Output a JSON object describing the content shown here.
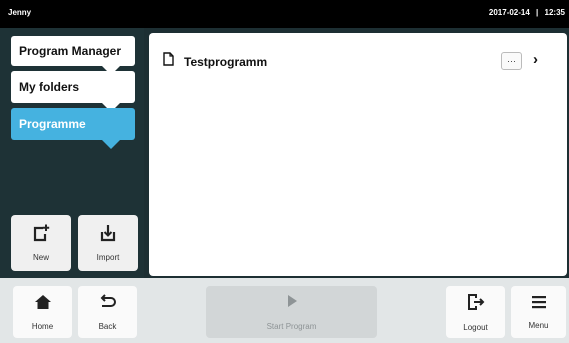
{
  "header": {
    "user": "Jenny",
    "date": "2017-02-14",
    "separator": "|",
    "time": "12:35"
  },
  "sidebar": {
    "nav": [
      {
        "label": "Program Manager"
      },
      {
        "label": "My folders"
      },
      {
        "label": "Programme",
        "active": true
      }
    ],
    "buttons": [
      {
        "label": "New",
        "icon": "new-file-icon"
      },
      {
        "label": "Import",
        "icon": "import-icon"
      }
    ]
  },
  "main": {
    "items": [
      {
        "name": "Testprogramm",
        "icon": "document-icon",
        "more_label": "···"
      }
    ]
  },
  "bottom": {
    "home": "Home",
    "back": "Back",
    "start": "Start Program",
    "logout": "Logout",
    "menu": "Menu"
  },
  "colors": {
    "accent": "#45b2e0",
    "sidebar_bg": "#1e3236",
    "topbar_bg": "#000000",
    "bottombar_bg": "#e2e6e7"
  }
}
